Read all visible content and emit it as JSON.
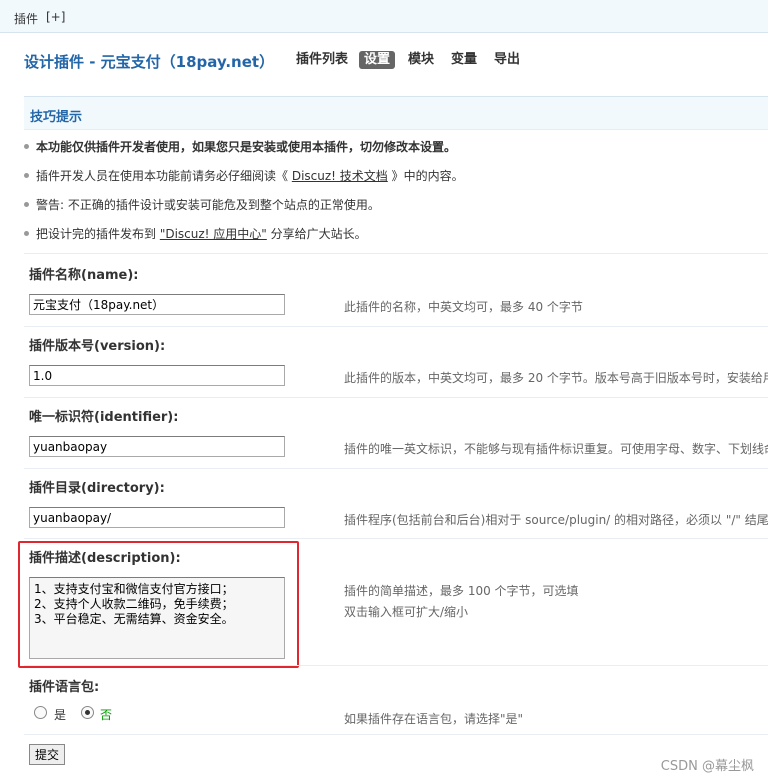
{
  "topbar": {
    "crumb": "插件",
    "add_link": "[+]"
  },
  "header": {
    "title": "设计插件 - 元宝支付（18pay.net）",
    "nav": [
      "插件列表",
      "设置",
      "模块",
      "变量",
      "导出"
    ],
    "active_nav": "设置"
  },
  "tips": {
    "title": "技巧提示",
    "item1": "本功能仅供插件开发者使用，如果您只是安装或使用本插件，切勿修改本设置。",
    "item2_pre": "插件开发人员在使用本功能前请务必仔细阅读《 ",
    "item2_link": "Discuz! 技术文档",
    "item2_post": " 》中的内容。",
    "item3": "警告: 不正确的插件设计或安装可能危及到整个站点的正常使用。",
    "item4_pre": "把设计完的插件发布到 ",
    "item4_link": "\"Discuz! 应用中心\"",
    "item4_post": " 分享给广大站长。"
  },
  "form": {
    "name": {
      "label": "插件名称(name):",
      "value": "元宝支付（18pay.net）",
      "hint": "此插件的名称，中英文均可，最多 40 个字节"
    },
    "version": {
      "label": "插件版本号(version):",
      "value": "1.0",
      "hint": "此插件的版本，中英文均可，最多 20 个字节。版本号高于旧版本号时，安装给用"
    },
    "identifier": {
      "label": "唯一标识符(identifier):",
      "value": "yuanbaopay",
      "hint": "插件的唯一英文标识，不能够与现有插件标识重复。可使用字母、数字、下划线命"
    },
    "directory": {
      "label": "插件目录(directory):",
      "value": "yuanbaopay/",
      "hint": "插件程序(包括前台和后台)相对于 source/plugin/ 的相对路径，必须以 \"/\" 结尾"
    },
    "description": {
      "label": "插件描述(description):",
      "value": "1、支持支付宝和微信支付官方接口；\n2、支持个人收款二维码，免手续费；\n3、平台稳定、无需结算、资金安全。",
      "hint1": "插件的简单描述，最多 100 个字节，可选填",
      "hint2": "双击输入框可扩大/缩小"
    },
    "langpack": {
      "label": "插件语言包:",
      "option_yes": "是",
      "option_no": "否",
      "selected": "否",
      "hint": "如果插件存在语言包，请选择\"是\""
    },
    "submit_label": "提交"
  },
  "watermark": "CSDN @幕尘枫"
}
